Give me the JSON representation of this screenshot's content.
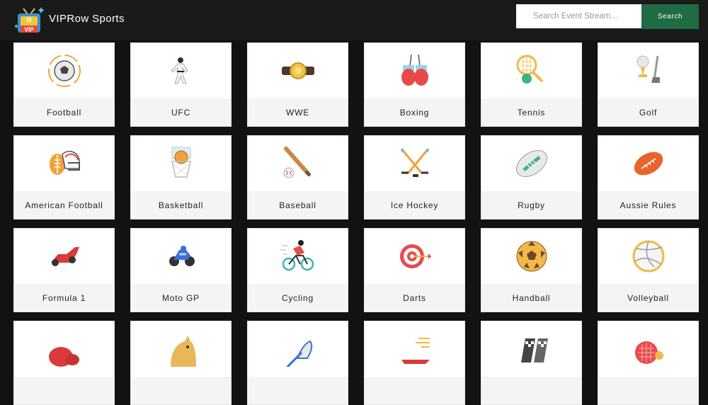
{
  "header": {
    "brand": "VIPRow Sports",
    "logo_text": "VIP",
    "search_placeholder": "Search Event Stream...",
    "search_button": "Search"
  },
  "colors": {
    "background": "#131111",
    "search_button": "#1f6b43"
  },
  "sports": [
    {
      "label": "Football",
      "icon": "soccer-ball-icon"
    },
    {
      "label": "UFC",
      "icon": "fighter-icon"
    },
    {
      "label": "WWE",
      "icon": "championship-belt-icon"
    },
    {
      "label": "Boxing",
      "icon": "boxing-gloves-icon"
    },
    {
      "label": "Tennis",
      "icon": "tennis-icon"
    },
    {
      "label": "Golf",
      "icon": "golf-icon"
    },
    {
      "label": "American Football",
      "icon": "football-helmet-icon"
    },
    {
      "label": "Basketball",
      "icon": "basketball-icon"
    },
    {
      "label": "Baseball",
      "icon": "baseball-icon"
    },
    {
      "label": "Ice Hockey",
      "icon": "hockey-sticks-icon"
    },
    {
      "label": "Rugby",
      "icon": "rugby-ball-icon"
    },
    {
      "label": "Aussie Rules",
      "icon": "aussie-rules-ball-icon"
    },
    {
      "label": "Formula 1",
      "icon": "race-car-icon"
    },
    {
      "label": "Moto GP",
      "icon": "motorbike-icon"
    },
    {
      "label": "Cycling",
      "icon": "cyclist-icon"
    },
    {
      "label": "Darts",
      "icon": "dartboard-icon"
    },
    {
      "label": "Handball",
      "icon": "handball-icon"
    },
    {
      "label": "Volleyball",
      "icon": "volleyball-icon"
    },
    {
      "label": "",
      "icon": "boxing-glove-icon"
    },
    {
      "label": "",
      "icon": "horse-icon"
    },
    {
      "label": "",
      "icon": "lacrosse-icon"
    },
    {
      "label": "",
      "icon": "race-car-speed-icon"
    },
    {
      "label": "",
      "icon": "checkered-flags-icon"
    },
    {
      "label": "",
      "icon": "ping-pong-icon"
    }
  ]
}
